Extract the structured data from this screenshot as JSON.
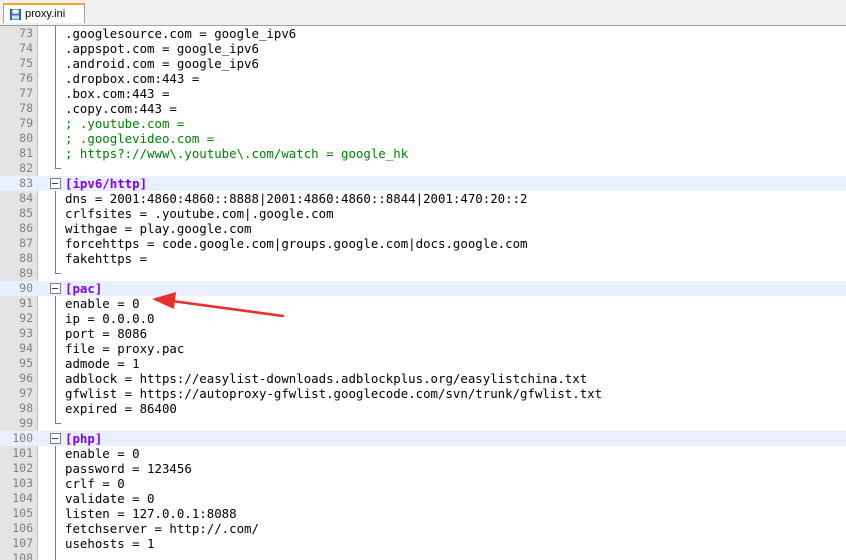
{
  "tab": {
    "label": "proxy.ini"
  },
  "lines": [
    {
      "n": "73",
      "t": ".googlesource.com = google_ipv6",
      "k": "kv",
      "f": "vline"
    },
    {
      "n": "74",
      "t": ".appspot.com = google_ipv6",
      "k": "kv",
      "f": "vline"
    },
    {
      "n": "75",
      "t": ".android.com = google_ipv6",
      "k": "kv",
      "f": "vline"
    },
    {
      "n": "76",
      "t": ".dropbox.com:443 =",
      "k": "kv",
      "f": "vline"
    },
    {
      "n": "77",
      "t": ".box.com:443 =",
      "k": "kv",
      "f": "vline"
    },
    {
      "n": "78",
      "t": ".copy.com:443 =",
      "k": "kv",
      "f": "vline"
    },
    {
      "n": "79",
      "t": "; .youtube.com =",
      "k": "comment",
      "f": "vline"
    },
    {
      "n": "80",
      "t": "; .googlevideo.com =",
      "k": "comment",
      "f": "vline"
    },
    {
      "n": "81",
      "t": "; https?://www\\.youtube\\.com/watch = google_hk",
      "k": "comment",
      "f": "vline"
    },
    {
      "n": "82",
      "t": "",
      "k": "kv",
      "f": "end"
    },
    {
      "n": "83",
      "t": "[ipv6/http]",
      "k": "section",
      "f": "box"
    },
    {
      "n": "84",
      "t": "dns = 2001:4860:4860::8888|2001:4860:4860::8844|2001:470:20::2",
      "k": "kv",
      "f": "vline"
    },
    {
      "n": "85",
      "t": "crlfsites = .youtube.com|.google.com",
      "k": "kv",
      "f": "vline"
    },
    {
      "n": "86",
      "t": "withgae = play.google.com",
      "k": "kv",
      "f": "vline"
    },
    {
      "n": "87",
      "t": "forcehttps = code.google.com|groups.google.com|docs.google.com",
      "k": "kv",
      "f": "vline"
    },
    {
      "n": "88",
      "t": "fakehttps =",
      "k": "kv",
      "f": "vline"
    },
    {
      "n": "89",
      "t": "",
      "k": "kv",
      "f": "end"
    },
    {
      "n": "90",
      "t": "[pac]",
      "k": "section",
      "f": "box"
    },
    {
      "n": "91",
      "t": "enable = 0",
      "k": "kv",
      "f": "vline"
    },
    {
      "n": "92",
      "t": "ip = 0.0.0.0",
      "k": "kv",
      "f": "vline"
    },
    {
      "n": "93",
      "t": "port = 8086",
      "k": "kv",
      "f": "vline"
    },
    {
      "n": "94",
      "t": "file = proxy.pac",
      "k": "kv",
      "f": "vline"
    },
    {
      "n": "95",
      "t": "admode = 1",
      "k": "kv",
      "f": "vline"
    },
    {
      "n": "96",
      "t": "adblock = https://easylist-downloads.adblockplus.org/easylistchina.txt",
      "k": "kv",
      "f": "vline"
    },
    {
      "n": "97",
      "t": "gfwlist = https://autoproxy-gfwlist.googlecode.com/svn/trunk/gfwlist.txt",
      "k": "kv",
      "f": "vline"
    },
    {
      "n": "98",
      "t": "expired = 86400",
      "k": "kv",
      "f": "vline"
    },
    {
      "n": "99",
      "t": "",
      "k": "kv",
      "f": "end"
    },
    {
      "n": "100",
      "t": "[php]",
      "k": "section",
      "f": "box"
    },
    {
      "n": "101",
      "t": "enable = 0",
      "k": "kv",
      "f": "vline"
    },
    {
      "n": "102",
      "t": "password = 123456",
      "k": "kv",
      "f": "vline"
    },
    {
      "n": "103",
      "t": "crlf = 0",
      "k": "kv",
      "f": "vline"
    },
    {
      "n": "104",
      "t": "validate = 0",
      "k": "kv",
      "f": "vline"
    },
    {
      "n": "105",
      "t": "listen = 127.0.0.1:8088",
      "k": "kv",
      "f": "vline"
    },
    {
      "n": "106",
      "t": "fetchserver = http://.com/",
      "k": "kv",
      "f": "vline"
    },
    {
      "n": "107",
      "t": "usehosts = 1",
      "k": "kv",
      "f": "vline"
    },
    {
      "n": "108",
      "t": "",
      "k": "kv",
      "f": "vline"
    }
  ],
  "colors": {
    "section": "#8000ff",
    "comment": "#008000",
    "arrow": "#e8302a",
    "tab_accent": "#f5a623"
  }
}
